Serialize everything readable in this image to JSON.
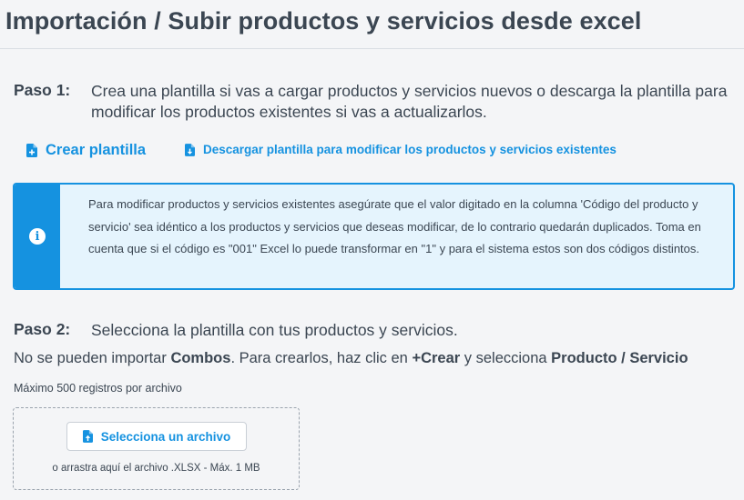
{
  "header": {
    "title": "Importación / Subir productos y servicios desde excel"
  },
  "step1": {
    "label": "Paso 1:",
    "text": "Crea una plantilla si vas a cargar productos y servicios nuevos o descarga la plantilla para modificar los productos existentes si vas a actualizarlos."
  },
  "actions": {
    "create_template": "Crear plantilla",
    "download_template": "Descargar plantilla para modificar los productos y servicios existentes"
  },
  "info": {
    "text": "Para modificar productos y servicios existentes asegúrate que el valor digitado en la columna 'Código del producto y servicio' sea idéntico a los productos y servicios que deseas modificar, de lo contrario quedarán duplicados. Toma en cuenta que si el código es \"001\" Excel lo puede transformar en \"1\" y para el sistema estos son dos códigos distintos."
  },
  "step2": {
    "label": "Paso 2:",
    "text": "Selecciona la plantilla con tus productos y servicios."
  },
  "combos_note": {
    "part1": "No se pueden importar ",
    "bold1": "Combos",
    "part2": ". Para crearlos, haz clic en ",
    "bold2": "+Crear",
    "part3": " y selecciona ",
    "bold3": "Producto / Servicio"
  },
  "upload": {
    "max_records": "Máximo 500 registros por archivo",
    "button_label": "Selecciona un archivo",
    "hint": "o arrastra aquí el archivo .XLSX - Máx. 1 MB"
  },
  "icons": {
    "create": "file-plus-icon",
    "download": "file-download-icon",
    "info": "info-icon",
    "upload": "file-upload-icon"
  },
  "colors": {
    "accent": "#1592e0",
    "info_background": "#e5f4fd",
    "text": "#3b4652",
    "page_background": "#f4f5f7"
  }
}
